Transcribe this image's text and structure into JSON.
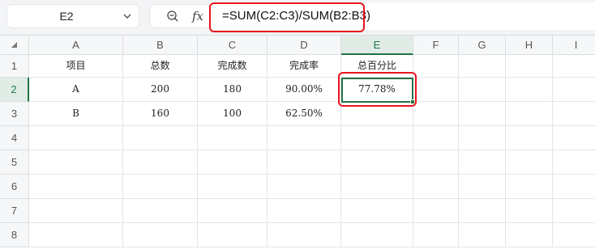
{
  "formula_bar": {
    "name_box": "E2",
    "name_box_chevron_icon": "chevron-down-icon",
    "zoom_icon": "zoom-out-icon",
    "fx_label": "fx",
    "formula": "=SUM(C2:C3)/SUM(B2:B3)"
  },
  "grid": {
    "select_all_icon": "triangle-icon",
    "columns": [
      "A",
      "B",
      "C",
      "D",
      "E",
      "F",
      "G",
      "H",
      "I"
    ],
    "rows": [
      "1",
      "2",
      "3",
      "4",
      "5",
      "6",
      "7",
      "8"
    ],
    "active_cell": {
      "column": "E",
      "row": "2"
    },
    "cells": {
      "A1": "项目",
      "B1": "总数",
      "C1": "完成数",
      "D1": "完成率",
      "E1": "总百分比",
      "A2": "A",
      "B2": "200",
      "C2": "180",
      "D2": "90.00%",
      "E2": "77.78%",
      "A3": "B",
      "B3": "160",
      "C3": "100",
      "D3": "62.50%",
      "E3": ""
    }
  },
  "colors": {
    "highlight_red": "#e8141b",
    "selection_green": "#217346"
  }
}
